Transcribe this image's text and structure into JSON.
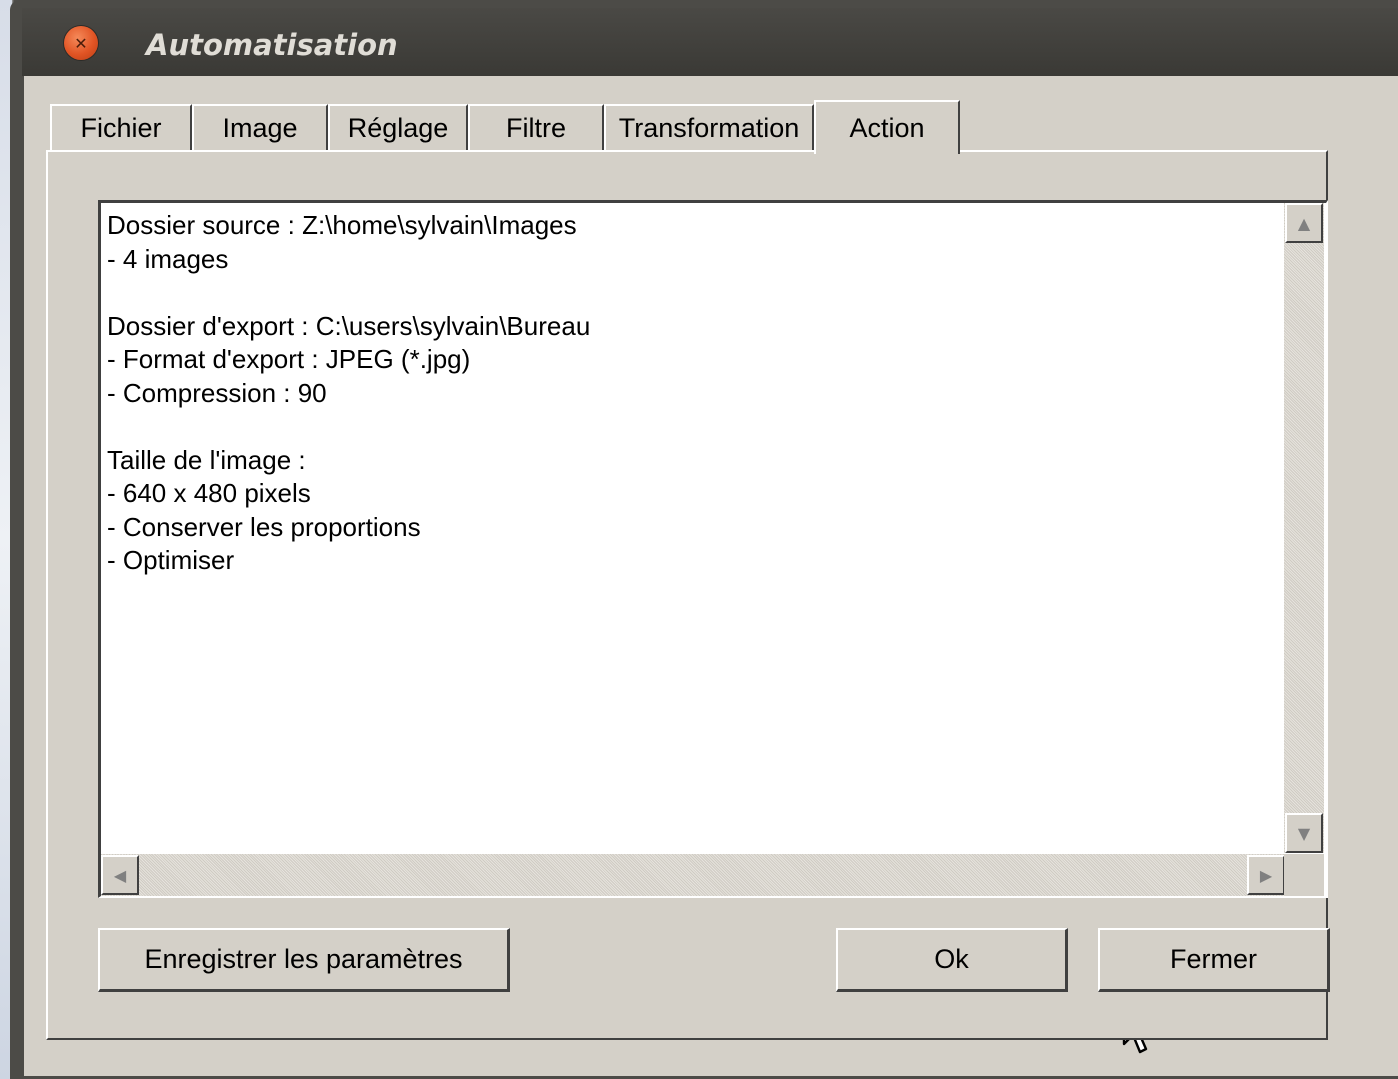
{
  "window": {
    "title": "Automatisation"
  },
  "tabs": [
    {
      "label": "Fichier"
    },
    {
      "label": "Image"
    },
    {
      "label": "Réglage"
    },
    {
      "label": "Filtre"
    },
    {
      "label": "Transformation"
    },
    {
      "label": "Action",
      "active": true
    }
  ],
  "summary": {
    "lines": [
      "Dossier source : Z:\\home\\sylvain\\Images",
      "- 4 images",
      "",
      "Dossier d'export : C:\\users\\sylvain\\Bureau",
      "- Format d'export : JPEG (*.jpg)",
      "- Compression : 90",
      "",
      "Taille de l'image :",
      "- 640 x 480 pixels",
      "- Conserver les proportions",
      "- Optimiser"
    ]
  },
  "buttons": {
    "save": "Enregistrer les paramètres",
    "ok": "Ok",
    "close": "Fermer"
  },
  "icons": {
    "close": "close-icon",
    "scroll_up": "arrow-up-icon",
    "scroll_down": "arrow-down-icon",
    "scroll_left": "arrow-left-icon",
    "scroll_right": "arrow-right-icon",
    "cursor": "mouse-pointer-icon"
  },
  "colors": {
    "dialog_face": "#d4d0c8",
    "titlebar": "#3f3e3a",
    "close_button": "#e15424"
  }
}
